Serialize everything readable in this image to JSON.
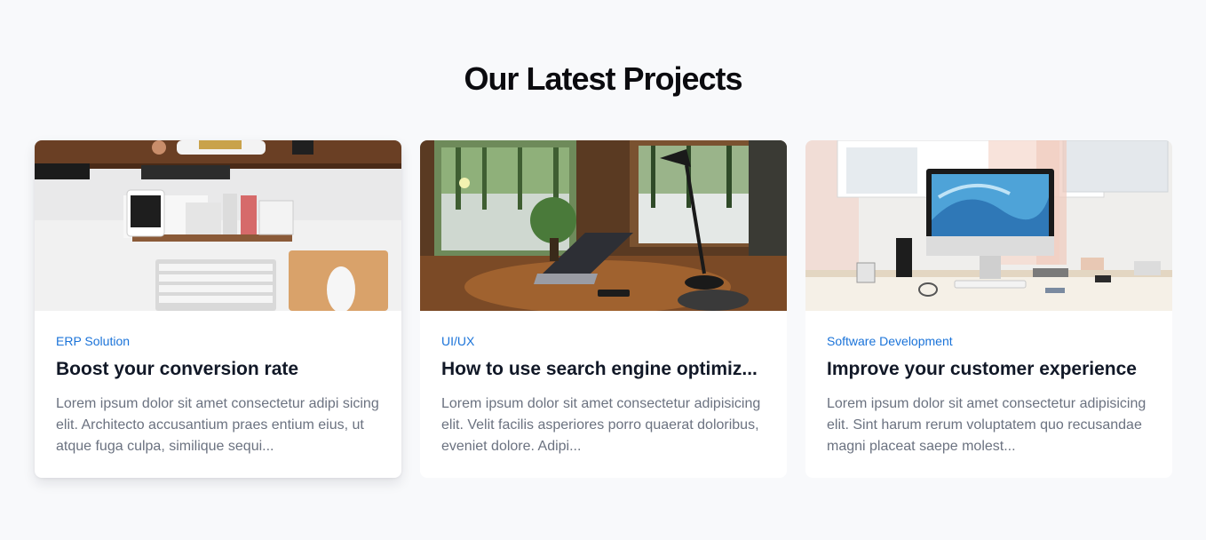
{
  "section": {
    "title": "Our Latest Projects"
  },
  "cards": [
    {
      "category": "ERP Solution",
      "title": "Boost your conversion rate",
      "description": "Lorem ipsum dolor sit amet consectetur adipi sicing elit. Architecto accusantium praes entium eius, ut atque fuga culpa, similique sequi...",
      "image": "desk-workspace-keyboard-mouse-photo"
    },
    {
      "category": "UI/UX",
      "title": "How to use search engine optimiz...",
      "description": "Lorem ipsum dolor sit amet consectetur adipisicing elit. Velit facilis asperiores porro quaerat doloribus, eveniet dolore. Adipi...",
      "image": "laptop-by-window-forest-photo"
    },
    {
      "category": "Software Development",
      "title": "Improve your customer experience",
      "description": "Lorem ipsum dolor sit amet consectetur adipisicing elit. Sint harum rerum voluptatem quo recusandae magni placeat saepe molest...",
      "image": "imac-desk-window-photo"
    }
  ],
  "colors": {
    "accent": "#1a73d9",
    "background": "#f8f9fb",
    "card": "#ffffff",
    "muted_text": "#6b7280"
  }
}
